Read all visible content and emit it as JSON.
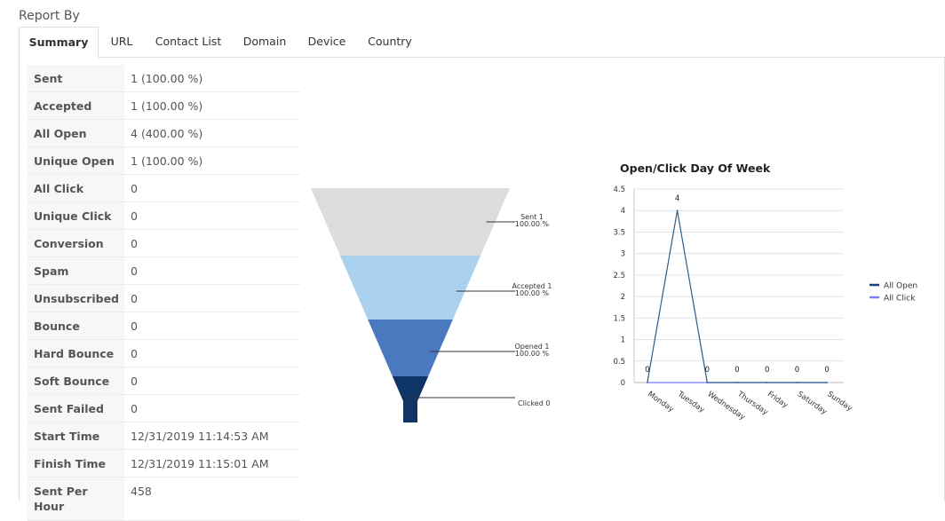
{
  "report": {
    "title": "Report By",
    "tabs": [
      "Summary",
      "URL",
      "Contact List",
      "Domain",
      "Device",
      "Country"
    ]
  },
  "summary": {
    "rows": [
      {
        "label": "Sent",
        "value": "1 (100.00 %)"
      },
      {
        "label": "Accepted",
        "value": "1 (100.00 %)"
      },
      {
        "label": "All Open",
        "value": "4 (400.00 %)"
      },
      {
        "label": "Unique Open",
        "value": "1 (100.00 %)"
      },
      {
        "label": "All Click",
        "value": "0"
      },
      {
        "label": "Unique Click",
        "value": "0"
      },
      {
        "label": "Conversion",
        "value": "0"
      },
      {
        "label": "Spam",
        "value": "0"
      },
      {
        "label": "Unsubscribed",
        "value": "0"
      },
      {
        "label": "Bounce",
        "value": "0"
      },
      {
        "label": "Hard Bounce",
        "value": "0"
      },
      {
        "label": "Soft Bounce",
        "value": "0"
      },
      {
        "label": "Sent Failed",
        "value": "0"
      },
      {
        "label": "Start Time",
        "value": "12/31/2019 11:14:53 AM"
      },
      {
        "label": "Finish Time",
        "value": "12/31/2019 11:15:01 AM"
      },
      {
        "label": "Sent Per Hour",
        "value": "458"
      }
    ]
  },
  "chart_data": [
    {
      "type": "funnel",
      "stages": [
        {
          "name": "Sent",
          "value": 1,
          "percent": "100.00 %",
          "color": "#dcdcdc"
        },
        {
          "name": "Accepted",
          "value": 1,
          "percent": "100.00 %",
          "color": "#aad2ef"
        },
        {
          "name": "Opened",
          "value": 1,
          "percent": "100.00 %",
          "color": "#4a79bf"
        },
        {
          "name": "Clicked",
          "value": 0,
          "percent": "",
          "color": "#0f3466"
        }
      ]
    },
    {
      "type": "line",
      "title": "Open/Click Day Of Week",
      "categories": [
        "Monday",
        "Tuesday",
        "Wednesday",
        "Thursday",
        "Friday",
        "Saturday",
        "Sunday"
      ],
      "series": [
        {
          "name": "All Open",
          "values": [
            0,
            4,
            0,
            0,
            0,
            0,
            0
          ],
          "color": "#2e5d8a",
          "legend_color": "#1a3e8c"
        },
        {
          "name": "All Click",
          "values": [
            0,
            0,
            0,
            0,
            0,
            0,
            0
          ],
          "color": "#7b7bff",
          "legend_color": "#7b7bff"
        }
      ],
      "yticks": [
        "0",
        "0.5",
        "1",
        "1.5",
        "2",
        "2.5",
        "3",
        "3.5",
        "4",
        "4.5"
      ],
      "ylim": [
        0,
        4.5
      ],
      "data_labels": [
        "0",
        "4",
        "0",
        "0",
        "0",
        "0",
        "0"
      ],
      "grid": true,
      "legend_position": "right"
    }
  ]
}
